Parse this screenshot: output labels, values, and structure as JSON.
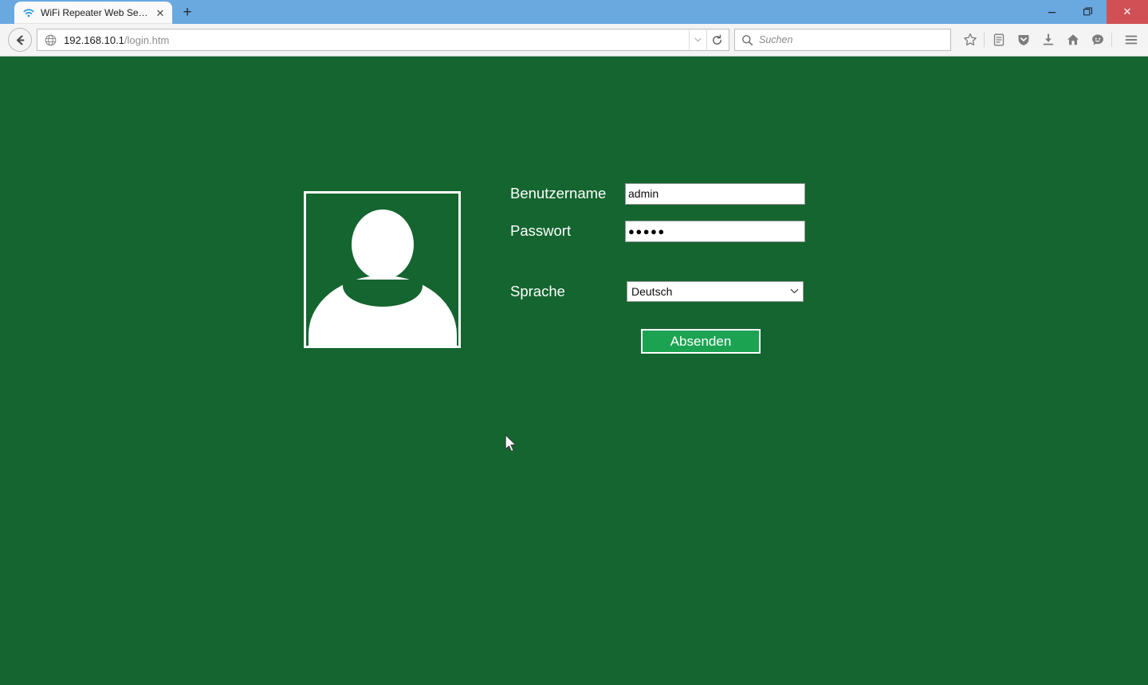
{
  "browser": {
    "tab": {
      "title": "WiFi Repeater Web Server",
      "favicon": "wifi-icon",
      "close_label": "✕"
    },
    "newtab_label": "+",
    "window_controls": {
      "minimize": "minimize-icon",
      "restore": "restore-icon",
      "close": "✕"
    },
    "nav": {
      "back_label": "←",
      "url_host": "192.168.10.1",
      "url_path": "/login.htm",
      "site_icon": "globe-icon",
      "dropdown_label": "▼",
      "reload_label": "↻"
    },
    "search": {
      "placeholder": "Suchen",
      "icon": "search-icon"
    },
    "toolbar_icons": [
      {
        "name": "bookmark-star-icon"
      },
      {
        "name": "library-icon"
      },
      {
        "name": "pocket-icon"
      },
      {
        "name": "downloads-icon"
      },
      {
        "name": "home-icon"
      },
      {
        "name": "sync-account-icon"
      },
      {
        "name": "menu-hamburger-icon"
      }
    ]
  },
  "page": {
    "background_color": "#14652f",
    "avatar_alt": "user-avatar",
    "form": {
      "username_label": "Benutzername",
      "username_value": "admin",
      "password_label": "Passwort",
      "password_value": "●●●●●",
      "language_label": "Sprache",
      "language_value": "Deutsch",
      "language_options": [
        "Deutsch"
      ],
      "submit_label": "Absenden"
    },
    "accent_color": "#1ca352"
  }
}
